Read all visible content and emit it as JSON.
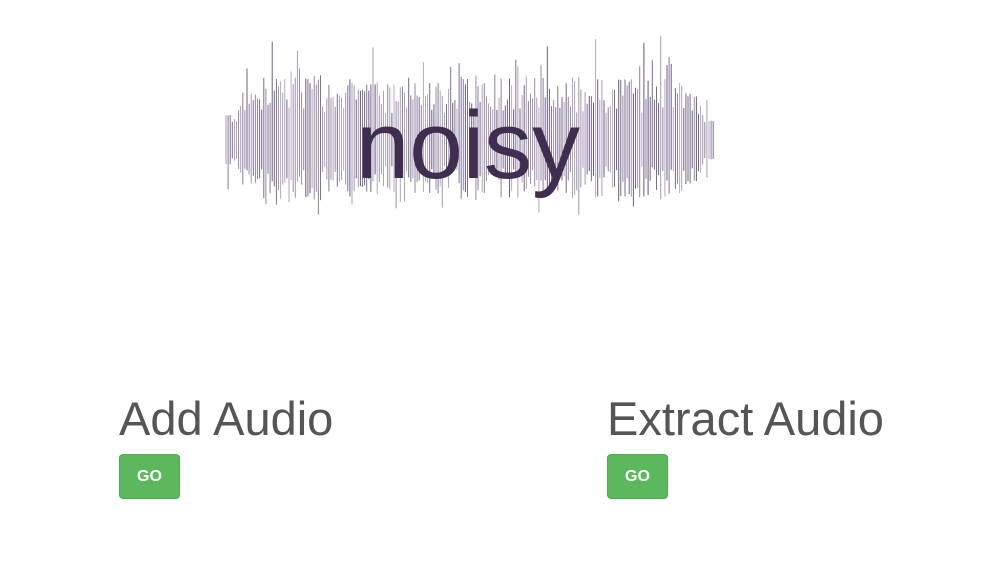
{
  "logo": {
    "text": "noisy",
    "text_color": "#3f2e4f",
    "wave_color": "#5f4b78"
  },
  "sections": [
    {
      "title": "Add Audio",
      "button_label": "GO"
    },
    {
      "title": "Extract Audio",
      "button_label": "GO"
    }
  ],
  "colors": {
    "button_bg": "#5cb85c",
    "button_border": "#4cae4c",
    "button_text": "#ffffff",
    "heading_text": "#555555"
  }
}
